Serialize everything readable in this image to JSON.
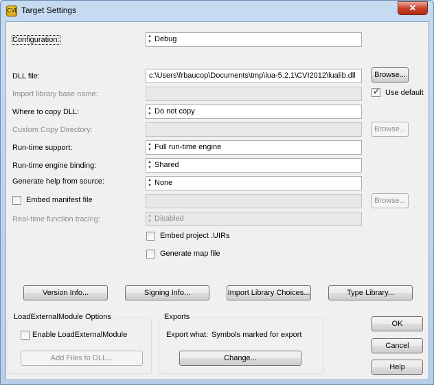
{
  "window": {
    "title": "Target Settings",
    "icon_text": "CVI",
    "close_glyph": "✕"
  },
  "form": {
    "configuration": {
      "label": "Configuration:",
      "value": "Debug"
    },
    "dll_file": {
      "label": "DLL file:",
      "value": "c:\\Users\\frbaucop\\Documents\\tmp\\lua-5.2.1\\CVI2012\\lualib.dll",
      "browse": "Browse..."
    },
    "import_lib": {
      "label": "Import library base name:",
      "value": "",
      "use_default_label": "Use default",
      "use_default_checked": true
    },
    "where_copy": {
      "label": "Where to copy DLL:",
      "value": "Do not copy"
    },
    "custom_copy": {
      "label": "Custom Copy Directory:",
      "value": "",
      "browse": "Browse..."
    },
    "runtime_support": {
      "label": "Run-time support:",
      "value": "Full run-time engine"
    },
    "runtime_binding": {
      "label": "Run-time engine binding:",
      "value": "Shared"
    },
    "gen_help": {
      "label": "Generate help from source:",
      "value": "None"
    },
    "embed_manifest": {
      "label": "Embed manifest file",
      "checked": false,
      "value": "",
      "browse": "Browse..."
    },
    "rt_tracing": {
      "label": "Real-time function tracing:",
      "value": "Disabled"
    },
    "embed_uirs": {
      "label": "Embed project .UIRs",
      "checked": false
    },
    "gen_map": {
      "label": "Generate map file",
      "checked": false
    }
  },
  "buttons_row": {
    "version_info": "Version Info...",
    "signing_info": "Signing Info...",
    "import_choices": "Import Library Choices...",
    "type_library": "Type Library..."
  },
  "load_external": {
    "title": "LoadExternalModule Options",
    "enable_label": "Enable LoadExternalModule",
    "enable_checked": false,
    "add_files": "Add Files to DLL..."
  },
  "exports": {
    "title": "Exports",
    "export_what_label": "Export what:",
    "export_what_value": "Symbols marked for export",
    "change": "Change..."
  },
  "dialog_buttons": {
    "ok": "OK",
    "cancel": "Cancel",
    "help": "Help"
  }
}
